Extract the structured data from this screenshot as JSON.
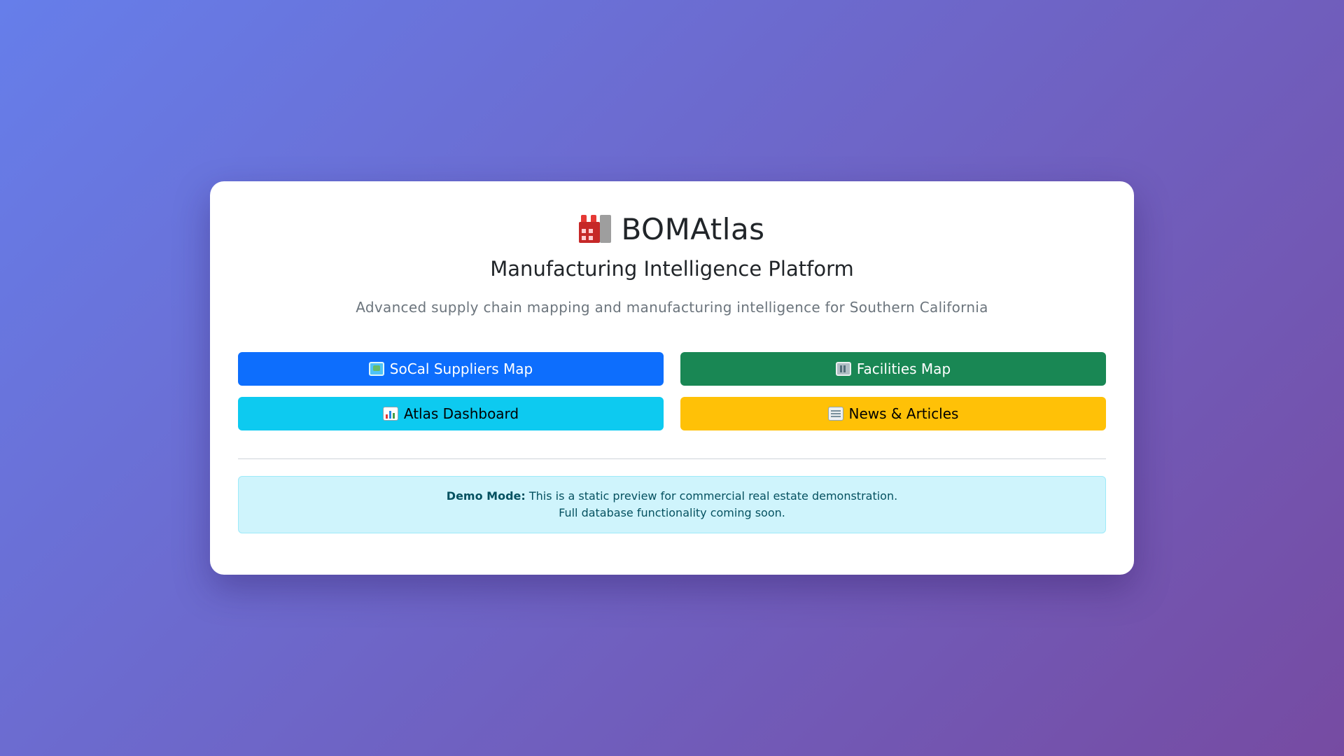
{
  "brand": {
    "title": "BOMAtlas",
    "icon": "factory-icon"
  },
  "subtitle": "Manufacturing Intelligence Platform",
  "tagline": "Advanced supply chain mapping and manufacturing intelligence for Southern California",
  "buttons": [
    {
      "label": "SoCal Suppliers Map",
      "icon": "world-map-icon",
      "color": "#0d6efd"
    },
    {
      "label": "Facilities Map",
      "icon": "office-building-icon",
      "color": "#198754"
    },
    {
      "label": "Atlas Dashboard",
      "icon": "bar-chart-icon",
      "color": "#0dcaf0"
    },
    {
      "label": "News & Articles",
      "icon": "newspaper-icon",
      "color": "#ffc107"
    }
  ],
  "alert": {
    "label": "Demo Mode:",
    "line1": "This is a static preview for commercial real estate demonstration.",
    "line2": "Full database functionality coming soon."
  }
}
